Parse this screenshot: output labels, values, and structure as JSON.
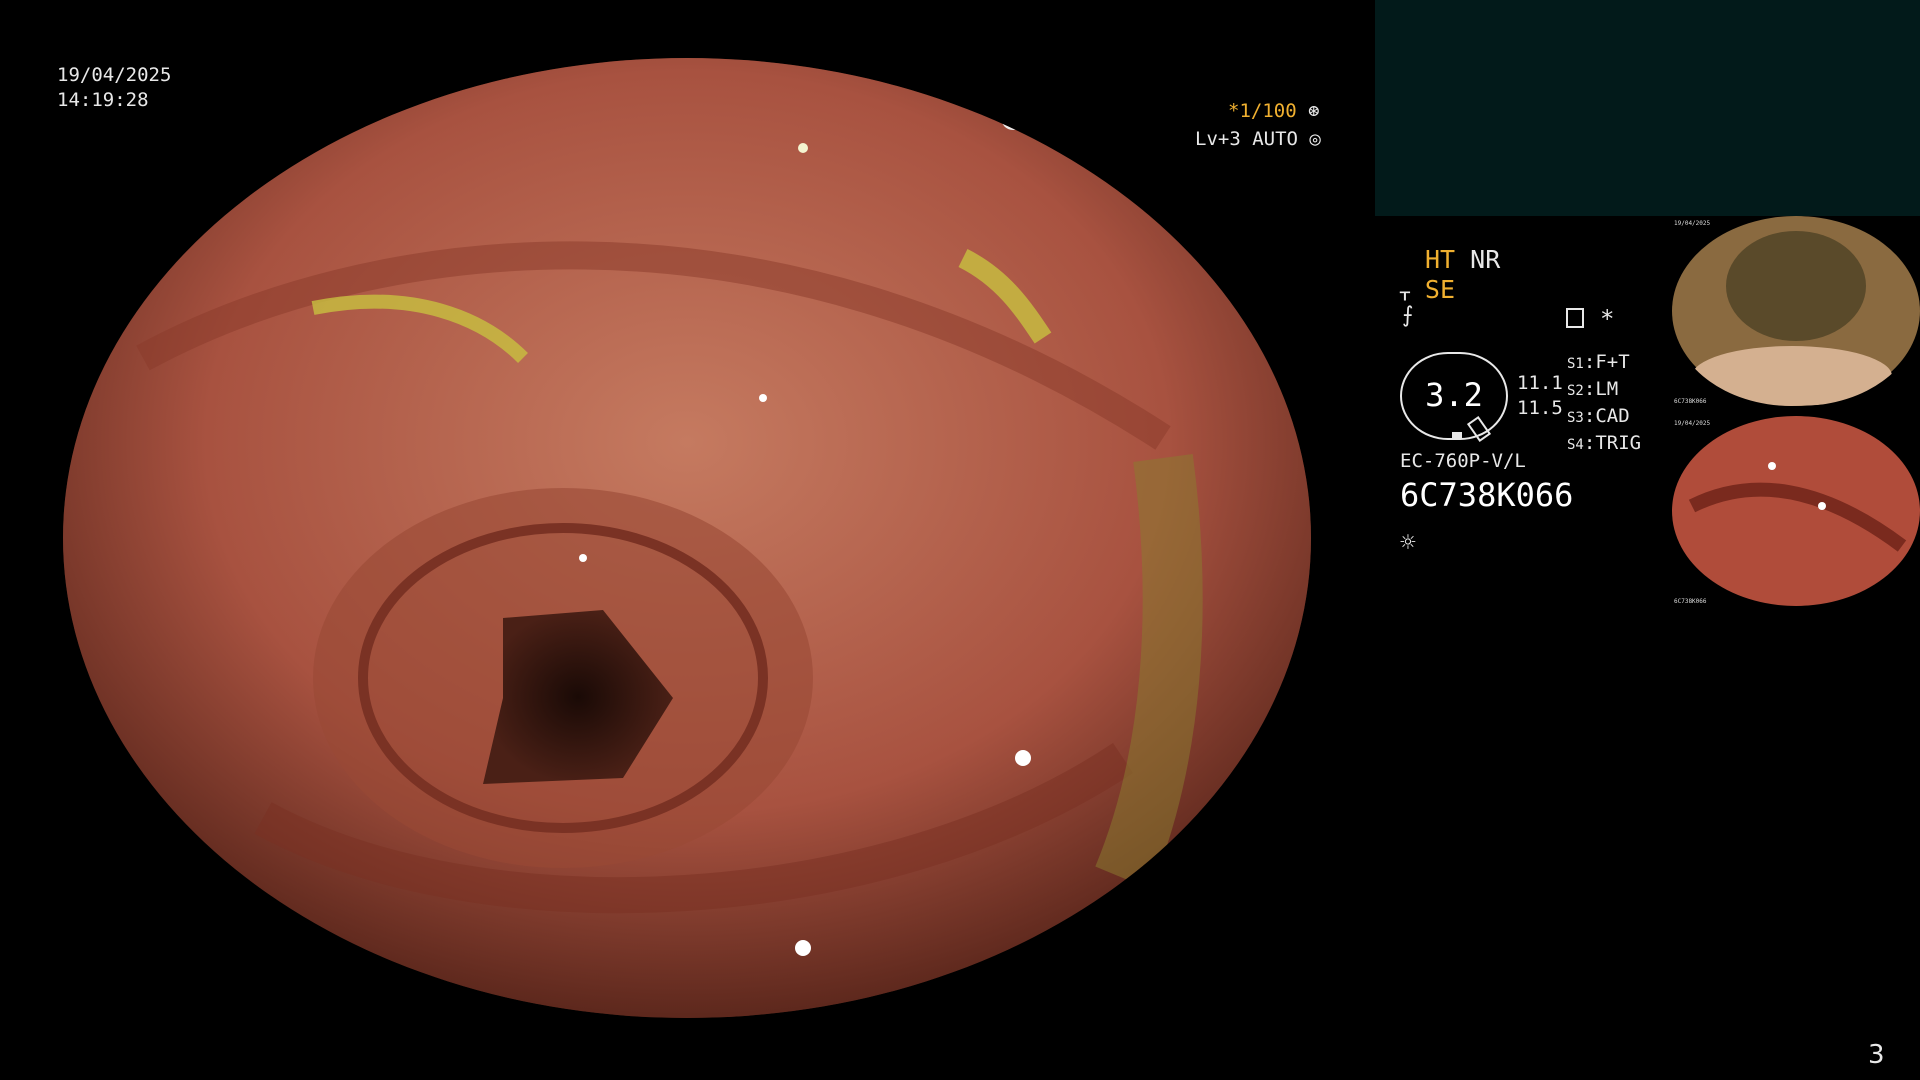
{
  "datetime": {
    "date": "19/04/2025",
    "time": "14:19:28"
  },
  "osd": {
    "shutter": "*1/100",
    "shutter_icon": "aperture-icon",
    "brightness": "Lv+3 AUTO",
    "brightness_icon": "iris-icon",
    "accent_color": "#f0b030"
  },
  "processor": {
    "ht": "HT",
    "nr": "NR",
    "se": "SE",
    "zoom": "3.2",
    "values": [
      "11.1",
      "11.5"
    ],
    "switches": [
      {
        "key": "S1",
        "value": "F+T"
      },
      {
        "key": "S2",
        "value": "LM"
      },
      {
        "key": "S3",
        "value": "CAD"
      },
      {
        "key": "S4",
        "value": "TRIG"
      }
    ],
    "scope_model": "EC-760P-V/L",
    "serial": "6C738K066",
    "asterisk": "*"
  },
  "thumbnails": [
    {
      "label_top": "19/04/2025",
      "label_bottom": "6C738K066"
    },
    {
      "label_top": "19/04/2025",
      "label_bottom": "6C738K066"
    }
  ],
  "page_number": "3",
  "colors": {
    "panel": "#021a1a",
    "mucosa": "#b5604a"
  }
}
